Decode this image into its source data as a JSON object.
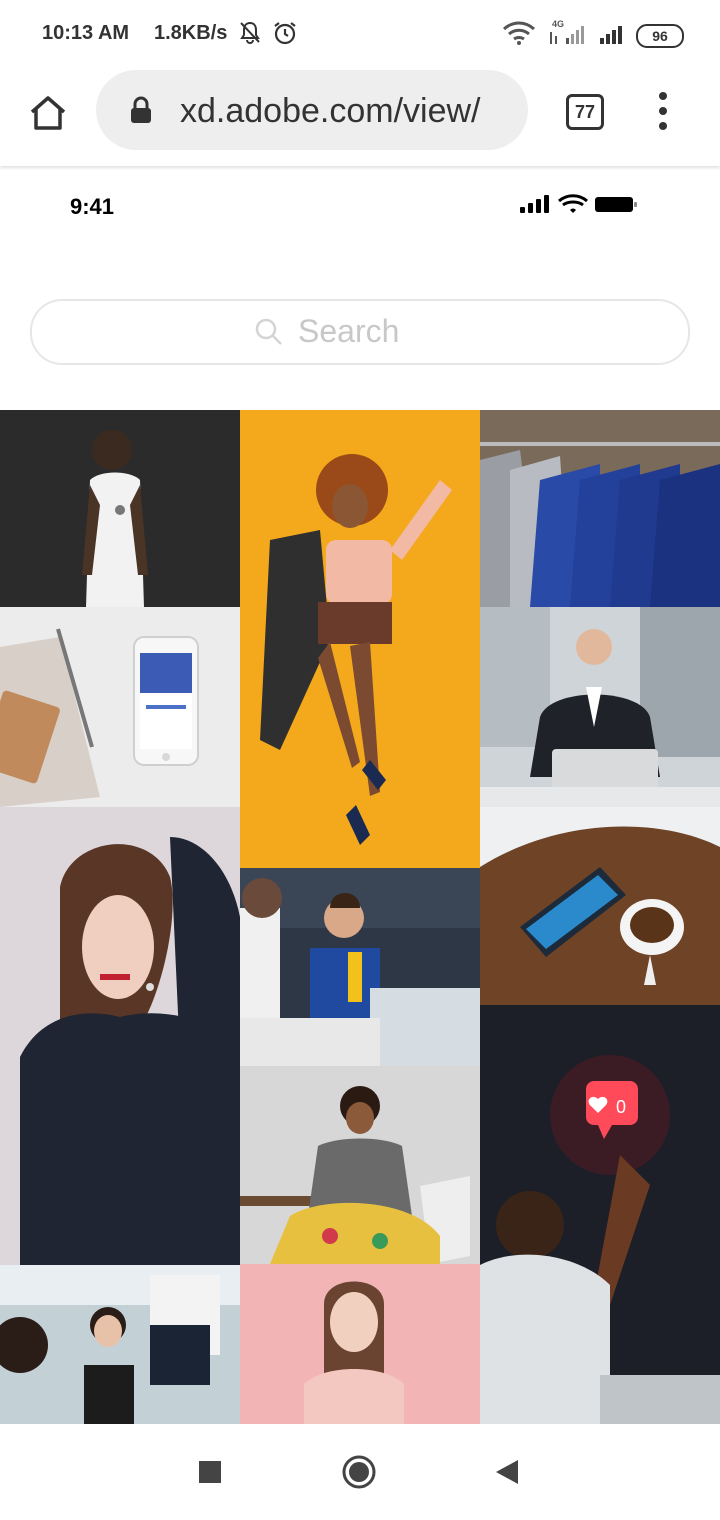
{
  "system_status": {
    "time": "10:13 AM",
    "net_speed": "1.8KB/s",
    "network_type": "4G",
    "battery": "96"
  },
  "browser": {
    "url": "xd.adobe.com/view/",
    "tab_count": "77"
  },
  "prototype": {
    "status_time": "9:41",
    "search_placeholder": "Search"
  },
  "grid": {
    "photos": [
      {
        "name": "man-white-tee",
        "bg": "#2a2a2a"
      },
      {
        "name": "woman-yellow-backdrop",
        "bg": "#f2a51c"
      },
      {
        "name": "suits-on-rack",
        "bg": "#243a7a"
      },
      {
        "name": "phone-facebook",
        "bg": "#e9e9e9"
      },
      {
        "name": "businessman-laptop",
        "bg": "#cfd3d6"
      },
      {
        "name": "phone-coffee-table",
        "bg": "#6b3f22"
      },
      {
        "name": "woman-polka-dots",
        "bg": "#d9d2d6"
      },
      {
        "name": "office-team",
        "bg": "#2f3a4a"
      },
      {
        "name": "woman-floral-dress",
        "bg": "#d8d8d8"
      },
      {
        "name": "man-instagram-like",
        "bg": "#1b1e26"
      },
      {
        "name": "women-office",
        "bg": "#b9c6cc"
      },
      {
        "name": "woman-pink-backdrop",
        "bg": "#f3b3b3"
      }
    ],
    "like_badge": "0"
  }
}
